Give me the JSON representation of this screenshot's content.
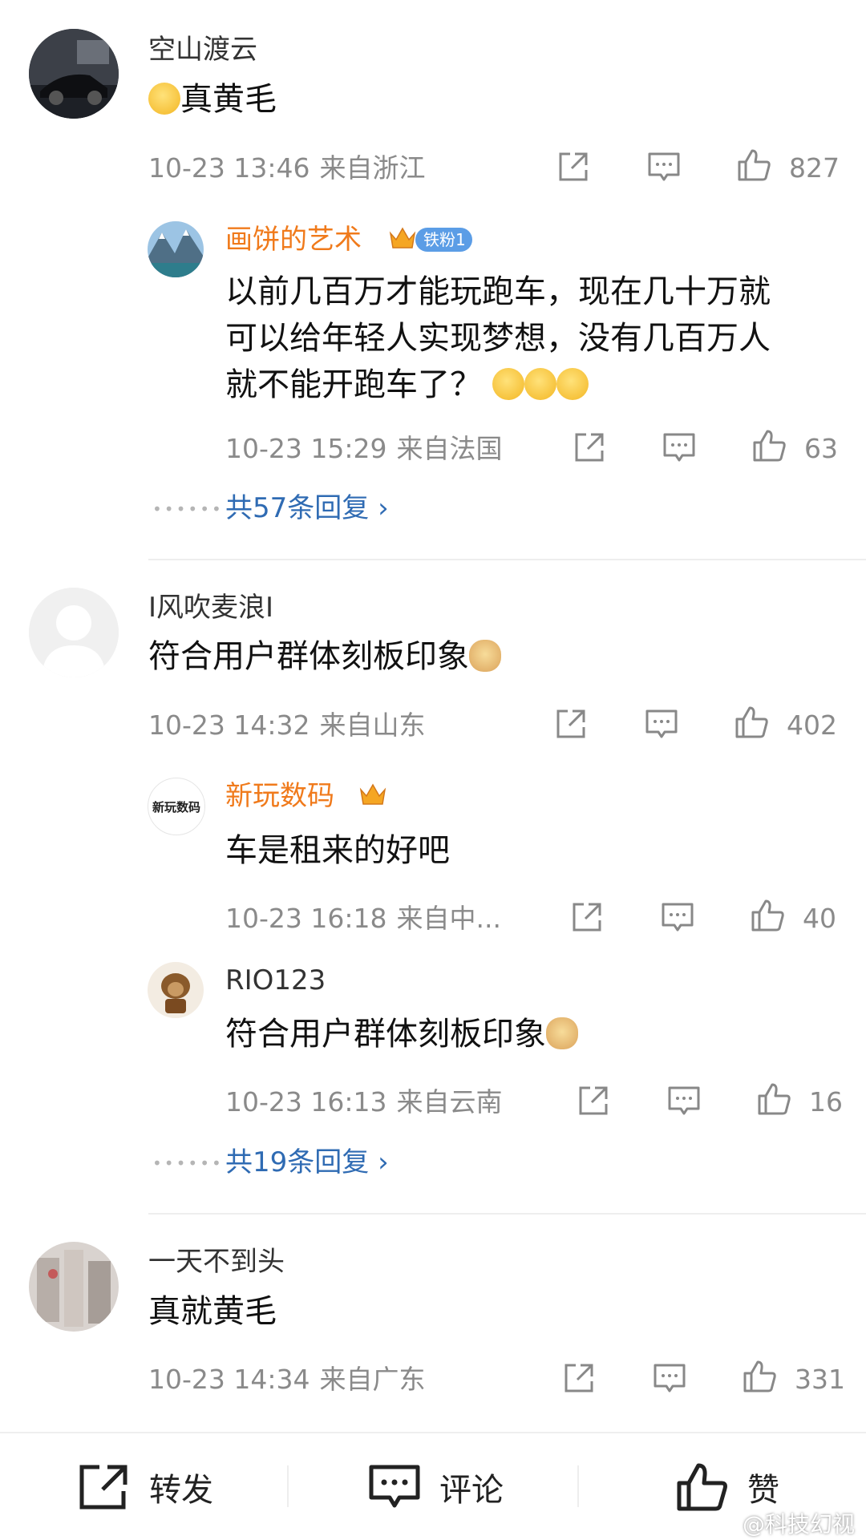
{
  "comments": [
    {
      "name": "空山渡云",
      "content": "真黄毛",
      "time": "10-23 13:46",
      "location": "来自浙江",
      "likes": "827",
      "replies": [
        {
          "name": "画饼的艺术",
          "fan_badge": "铁粉1",
          "content_lines": [
            "以前几百万才能玩跑车，现在几十万就",
            "可以给年轻人实现梦想，没有几百万人",
            "就不能开跑车了？"
          ],
          "time": "10-23 15:29",
          "location": "来自法国",
          "likes": "63"
        }
      ],
      "more_replies": "共57条回复"
    },
    {
      "name": "I风吹麦浪I",
      "content": "符合用户群体刻板印象",
      "time": "10-23 14:32",
      "location": "来自山东",
      "likes": "402",
      "replies": [
        {
          "name": "新玩数码",
          "avatar_text": "新玩数码",
          "content": "车是租来的好吧",
          "time": "10-23 16:18",
          "location": "来自中...",
          "likes": "40"
        },
        {
          "name": "RIO123",
          "content": "符合用户群体刻板印象",
          "time": "10-23 16:13",
          "location": "来自云南",
          "likes": "16"
        }
      ],
      "more_replies": "共19条回复"
    },
    {
      "name": "一天不到头",
      "content": "真就黄毛",
      "time": "10-23 14:34",
      "location": "来自广东",
      "likes": "331"
    }
  ],
  "bottom_bar": {
    "repost": "转发",
    "comment": "评论",
    "like": "赞"
  },
  "watermark": "@科技幻视",
  "colors": {
    "vip_name": "#f07a1b",
    "link": "#2f6bb3",
    "meta": "#8a8a8a",
    "fan_badge": "#5b9de6"
  }
}
